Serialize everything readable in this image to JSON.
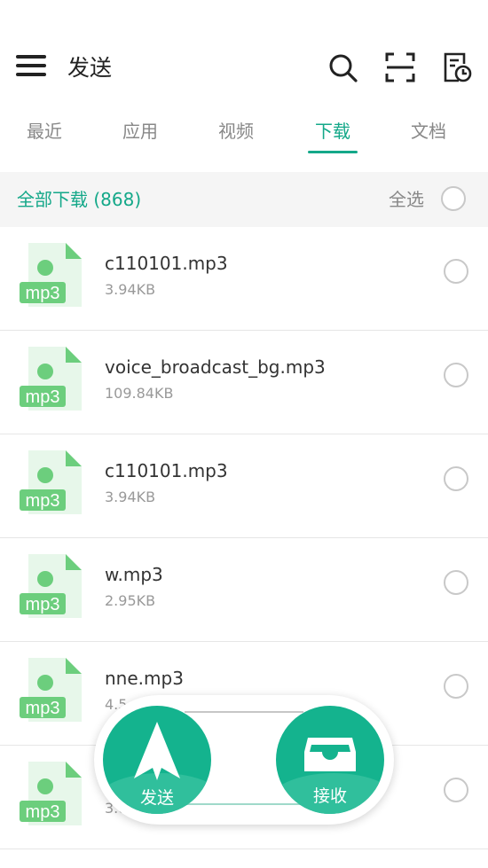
{
  "header": {
    "title": "发送",
    "icons": [
      "menu-icon",
      "search-icon",
      "scan-icon",
      "history-icon"
    ]
  },
  "tabs": [
    {
      "label": "最近",
      "active": false
    },
    {
      "label": "应用",
      "active": false
    },
    {
      "label": "视频",
      "active": false
    },
    {
      "label": "下载",
      "active": true
    },
    {
      "label": "文档",
      "active": false
    }
  ],
  "section": {
    "title": "全部下载  (868)",
    "select_all_label": "全选"
  },
  "files": [
    {
      "name": "c110101.mp3",
      "size": "3.94KB",
      "type": "mp3"
    },
    {
      "name": "voice_broadcast_bg.mp3",
      "size": "109.84KB",
      "type": "mp3"
    },
    {
      "name": "c110101.mp3",
      "size": "3.94KB",
      "type": "mp3"
    },
    {
      "name": "w.mp3",
      "size": "2.95KB",
      "type": "mp3"
    },
    {
      "name": "nne.mp3",
      "size": "4.5",
      "type": "mp3"
    },
    {
      "name": "",
      "size": "3.8",
      "type": "mp3"
    }
  ],
  "dock": {
    "send_label": "发送",
    "receive_label": "接收"
  },
  "colors": {
    "accent": "#14a889",
    "dock_green": "#14b38e",
    "file_icon_green": "#6cce7d"
  }
}
